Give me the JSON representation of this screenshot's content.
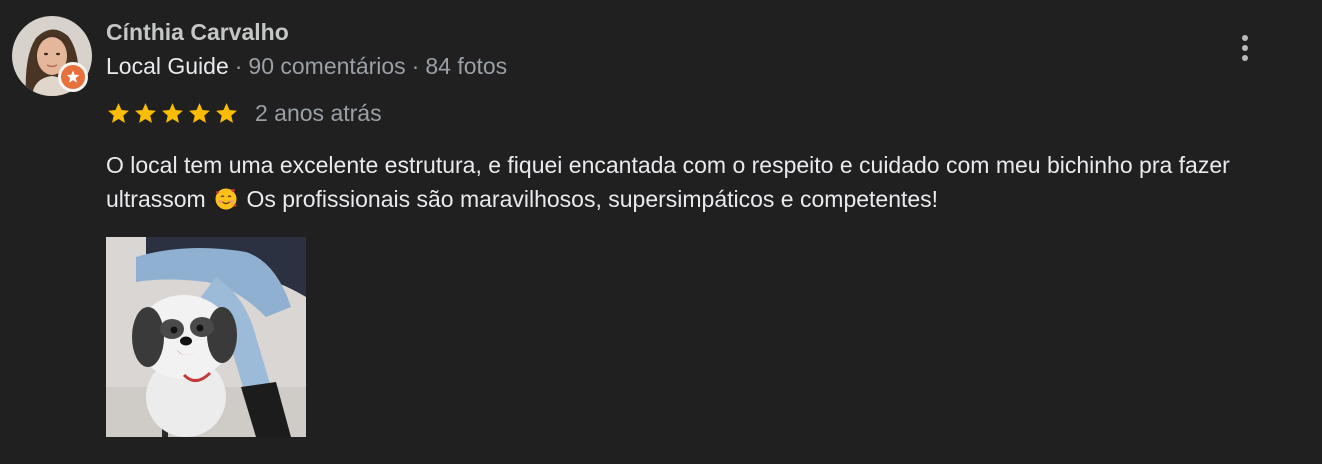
{
  "review": {
    "author": {
      "name": "Cínthia Carvalho",
      "badge": "Local Guide",
      "reviews_count": "90 comentários",
      "photos_count": "84 fotos",
      "separator": "·"
    },
    "rating": 5,
    "rating_max": 5,
    "time_ago": "2 anos atrás",
    "text_part1": "O local tem uma excelente estrutura, e fiquei encantada com o respeito e cuidado com meu bichinho pra fazer ultrassom",
    "emoji": "smiling-face-with-hearts",
    "text_part2": "Os profissionais são maravilhosos, supersimpáticos e competentes!",
    "photos": [
      "dog-photo"
    ]
  },
  "colors": {
    "background": "#202020",
    "star": "#fbbc04",
    "guide_badge": "#e8703a",
    "text_primary": "#e8eaed",
    "text_secondary": "#9aa0a6"
  },
  "icons": {
    "more": "more-vertical-icon",
    "star": "star-icon",
    "badge": "local-guide-badge-icon"
  }
}
